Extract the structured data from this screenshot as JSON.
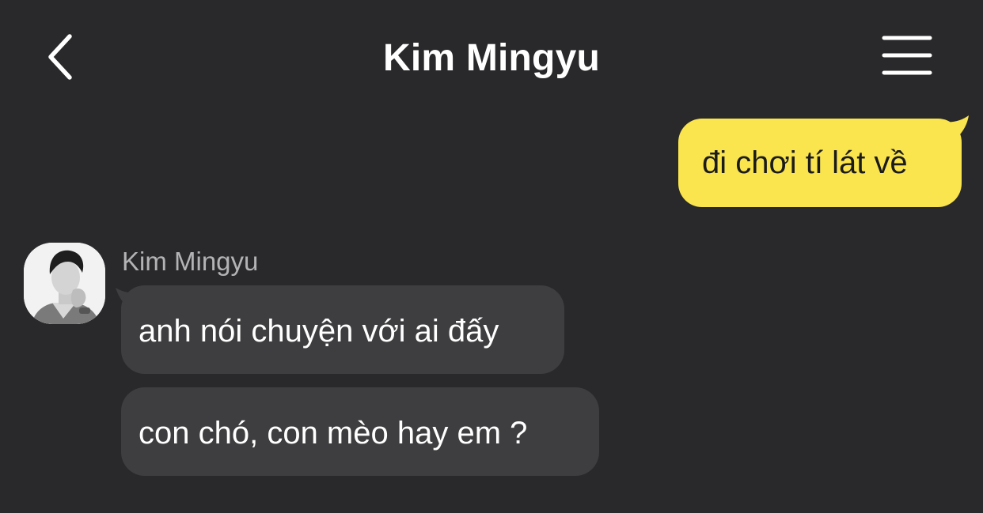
{
  "header": {
    "title": "Kim Mingyu",
    "back_icon": "chevron-left-icon",
    "menu_icon": "hamburger-menu-icon"
  },
  "messages": [
    {
      "direction": "outgoing",
      "text": "đi chơi tí lát về"
    },
    {
      "direction": "incoming",
      "sender": "Kim Mingyu",
      "text": "anh nói chuyện với ai đấy"
    },
    {
      "direction": "incoming",
      "sender": "Kim Mingyu",
      "text": "con chó, con mèo hay em ?"
    }
  ],
  "colors": {
    "background": "#29292b",
    "outgoing_bubble": "#fae54f",
    "incoming_bubble": "#3e3e40",
    "sender_name": "#b3b3b5"
  }
}
